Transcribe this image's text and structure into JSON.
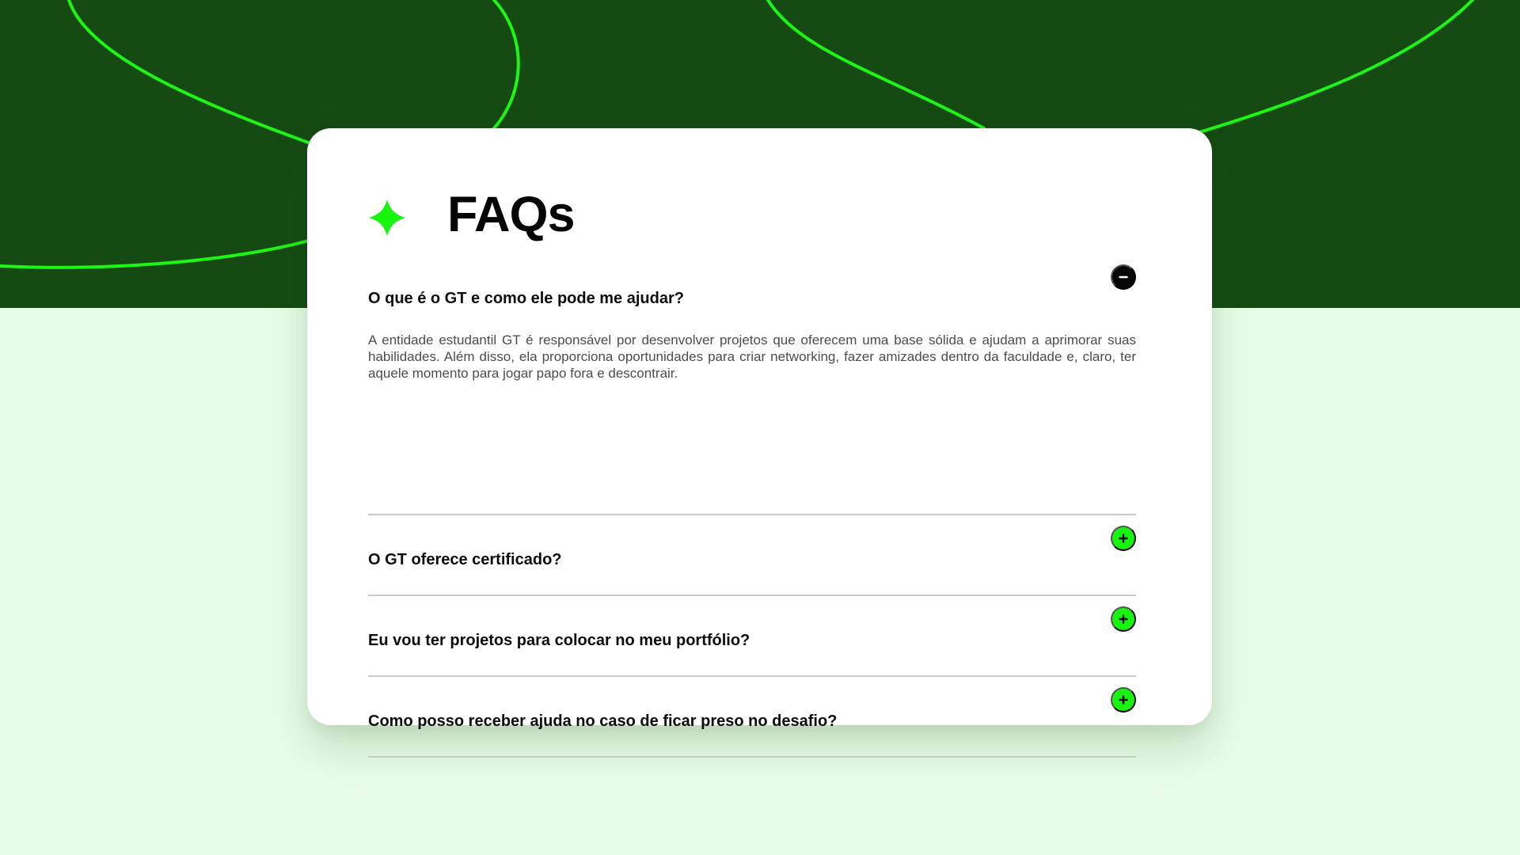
{
  "faq": {
    "title": "FAQs",
    "items": [
      {
        "question": "O que é o GT e como ele pode me ajudar?",
        "answer": "A entidade estudantil GT é responsável por desenvolver projetos que oferecem uma base sólida e ajudam a aprimorar suas habilidades. Além disso, ela proporciona oportunidades para criar networking, fazer amizades dentro da faculdade e, claro, ter aquele momento para jogar papo fora e descontrair.",
        "expanded": true,
        "toggle_icon": "minus-circle-icon"
      },
      {
        "question": "O GT oferece certificado?",
        "expanded": false,
        "toggle_icon": "plus-circle-icon"
      },
      {
        "question": "Eu vou ter projetos para colocar no meu portfólio?",
        "expanded": false,
        "toggle_icon": "plus-circle-icon"
      },
      {
        "question": "Como posso receber ajuda no caso de ficar preso no desafio?",
        "expanded": false,
        "toggle_icon": "plus-circle-icon"
      }
    ]
  },
  "icons": {
    "title_decoration": "four-point-star-icon"
  },
  "colors": {
    "hero_background": "#154a13",
    "page_background": "#e8fde7",
    "accent_green": "#17f50f",
    "text_primary": "#0d0d0d",
    "text_secondary": "#4c4c4c",
    "divider": "#c8c8c8"
  }
}
